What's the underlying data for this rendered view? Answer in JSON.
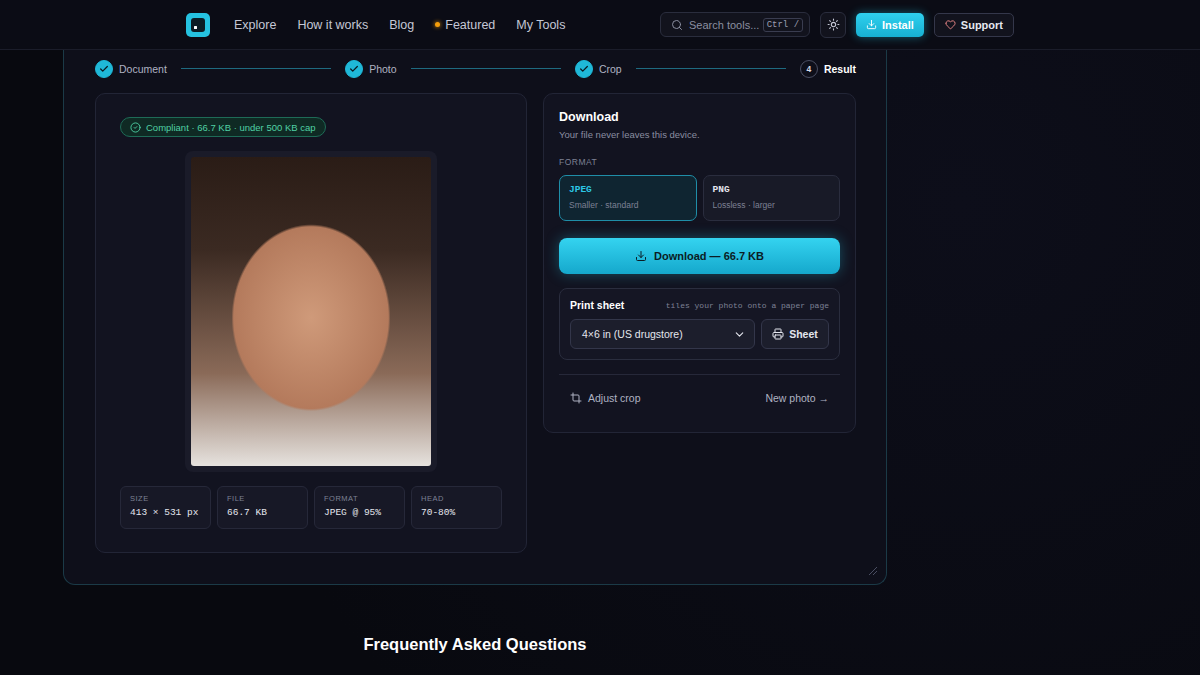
{
  "nav": {
    "links": [
      {
        "label": "Explore",
        "featured": false
      },
      {
        "label": "How it works",
        "featured": false
      },
      {
        "label": "Blog",
        "featured": false
      },
      {
        "label": "Featured",
        "featured": true
      },
      {
        "label": "My Tools",
        "featured": false
      }
    ],
    "search": {
      "placeholder": "Search tools...",
      "shortcut": "Ctrl /"
    },
    "install": "Install",
    "support": "Support"
  },
  "steps": [
    {
      "label": "Document",
      "done": true,
      "selected": false
    },
    {
      "label": "Photo",
      "done": true,
      "selected": false
    },
    {
      "label": "Crop",
      "done": true,
      "selected": false
    },
    {
      "label": "Result",
      "number": "4",
      "done": false,
      "selected": true
    }
  ],
  "badge": {
    "text": "Compliant · 66.7 KB · under 500 KB cap",
    "compliant": true
  },
  "stats": [
    {
      "label": "SIZE",
      "value": "413 × 531 px"
    },
    {
      "label": "FILE",
      "value": "66.7 KB"
    },
    {
      "label": "FORMAT",
      "value": "JPEG @ 95%"
    },
    {
      "label": "HEAD",
      "value": "70-80%"
    }
  ],
  "download": {
    "title": "Download",
    "subtitle": "Your file never leaves this device.",
    "format_label": "FORMAT",
    "formats": [
      {
        "name": "JPEG",
        "hint": "Smaller · standard",
        "selected": true
      },
      {
        "name": "PNG",
        "hint": "Lossless · larger",
        "selected": false
      }
    ],
    "button": "Download — 66.7 KB"
  },
  "print_sheet": {
    "title": "Print sheet",
    "hint": "tiles your photo onto a paper page",
    "paper": "4×6 in (US drugstore)",
    "button": "Sheet"
  },
  "actions": {
    "adjust": "Adjust crop",
    "new_photo": "New photo →"
  },
  "faq": {
    "title": "Frequently Asked Questions"
  }
}
